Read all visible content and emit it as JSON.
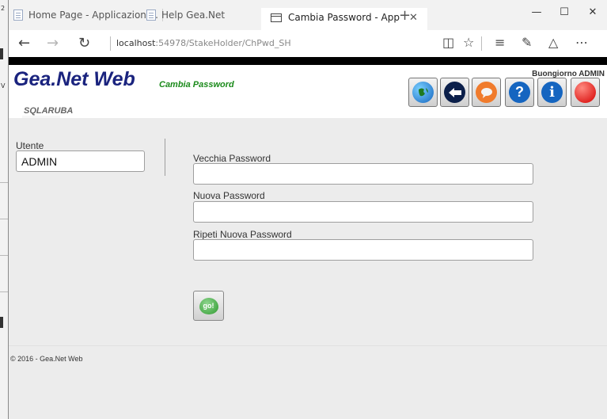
{
  "tabs": [
    {
      "label": "Home Page - Applicazione ."
    },
    {
      "label": "Help Gea.Net"
    },
    {
      "label": "Cambia Password - App"
    }
  ],
  "window": {
    "minimize": "—",
    "maximize": "☐",
    "close": "✕",
    "new_tab": "+",
    "tab_close": "✕"
  },
  "address_bar": {
    "host": "localhost",
    "path": ":54978/StakeHolder/ChPwd_SH"
  },
  "toolbar_icons": [
    "reading-view-icon",
    "favorites-star-icon",
    "hub-icon",
    "web-note-icon",
    "share-icon",
    "more-icon"
  ],
  "left_strip": {
    "chars": [
      "2",
      "V"
    ]
  },
  "header": {
    "app_title": "Gea.Net Web",
    "page_subtitle": "Cambia Password",
    "database": "SQLARUBA",
    "greeting": "Buongiorno ADMIN",
    "buttons": [
      {
        "name": "globe",
        "color": "#1f7a1f"
      },
      {
        "name": "back",
        "color": "#0b1f4a"
      },
      {
        "name": "chat",
        "color": "#f07b2c"
      },
      {
        "name": "help",
        "color": "#1565c0",
        "glyph": "?"
      },
      {
        "name": "info",
        "color": "#1565c0",
        "glyph": "i"
      },
      {
        "name": "logout",
        "color": "#d50000"
      }
    ]
  },
  "form": {
    "user_label": "Utente",
    "user_value": "ADMIN",
    "old_password_label": "Vecchia Password",
    "old_password_value": "",
    "new_password_label": "Nuova Password",
    "new_password_value": "",
    "repeat_password_label": "Ripeti Nuova Password",
    "repeat_password_value": "",
    "submit_label": "go!"
  },
  "footer": {
    "text": "© 2016 - Gea.Net Web"
  }
}
